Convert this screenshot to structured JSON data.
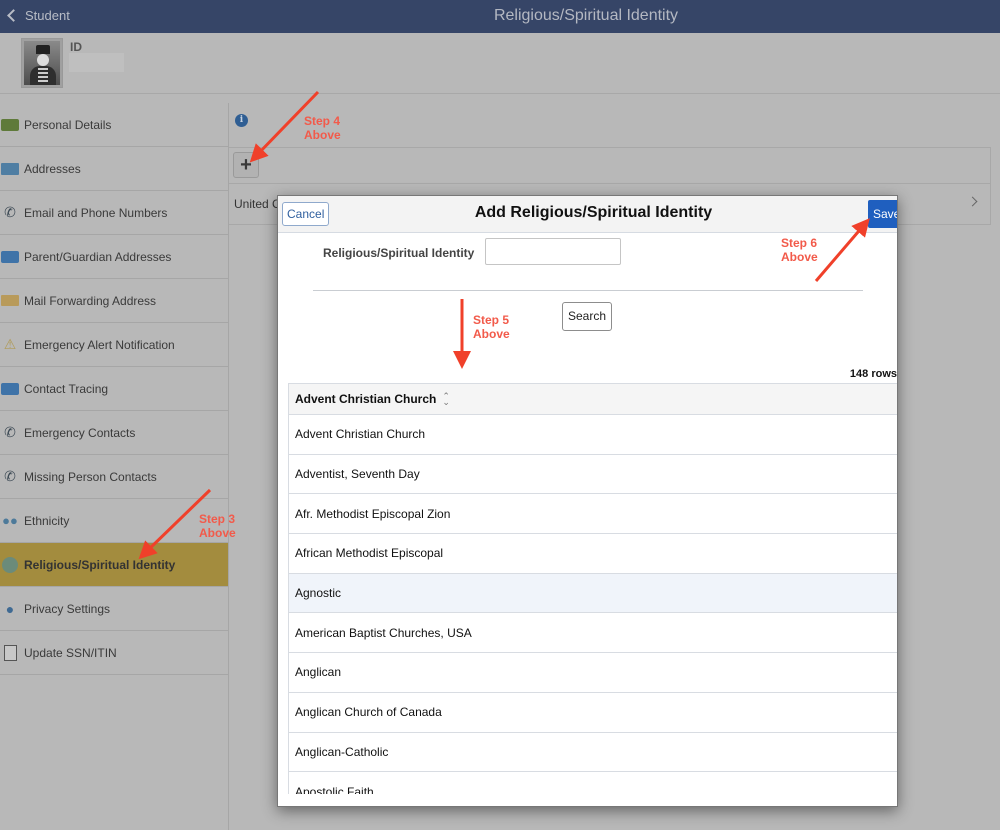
{
  "header": {
    "back_label": "Student",
    "page_title": "Religious/Spiritual Identity"
  },
  "profile": {
    "id_label": "ID",
    "id_value": ""
  },
  "sidebar": {
    "items": [
      {
        "label": "Personal Details",
        "icon": "id-card-icon",
        "active": false
      },
      {
        "label": "Addresses",
        "icon": "envelope-icon",
        "active": false
      },
      {
        "label": "Email and Phone Numbers",
        "icon": "phone-email-icon",
        "active": false
      },
      {
        "label": "Parent/Guardian Addresses",
        "icon": "contact-card-icon",
        "active": false
      },
      {
        "label": "Mail Forwarding Address",
        "icon": "mail-icon",
        "active": false
      },
      {
        "label": "Emergency Alert Notification",
        "icon": "warning-icon",
        "active": false
      },
      {
        "label": "Contact Tracing",
        "icon": "contact-card-icon",
        "active": false
      },
      {
        "label": "Emergency Contacts",
        "icon": "phone-medical-icon",
        "active": false
      },
      {
        "label": "Missing Person Contacts",
        "icon": "phone-at-icon",
        "active": false
      },
      {
        "label": "Ethnicity",
        "icon": "people-icon",
        "active": false
      },
      {
        "label": "Religious/Spiritual Identity",
        "icon": "globe-icon",
        "active": true
      },
      {
        "label": "Privacy Settings",
        "icon": "user-lock-icon",
        "active": false
      },
      {
        "label": "Update SSN/ITIN",
        "icon": "document-check-icon",
        "active": false
      }
    ]
  },
  "main": {
    "add_button_label": "+",
    "existing_row_text": "United C"
  },
  "modal": {
    "title": "Add Religious/Spiritual Identity",
    "cancel_label": "Cancel",
    "save_label": "Save",
    "search_field_label": "Religious/Spiritual Identity",
    "search_field_value": "",
    "search_button_label": "Search",
    "row_count": "148 rows",
    "column_header": "Advent Christian Church",
    "rows": [
      "Advent Christian Church",
      "Adventist, Seventh Day",
      "Afr. Methodist Episcopal Zion",
      "African Methodist Episcopal",
      "Agnostic",
      "American Baptist Churches, USA",
      "Anglican",
      "Anglican Church of Canada",
      "Anglican-Catholic",
      "Apostolic Faith"
    ],
    "highlighted_row": "Agnostic"
  },
  "annotations": {
    "step3": [
      "Step 3",
      "Above"
    ],
    "step4": [
      "Step 4",
      "Above"
    ],
    "step5": [
      "Step 5",
      "Above"
    ],
    "step6": [
      "Step 6",
      "Above"
    ],
    "color": "#f25a4a"
  }
}
